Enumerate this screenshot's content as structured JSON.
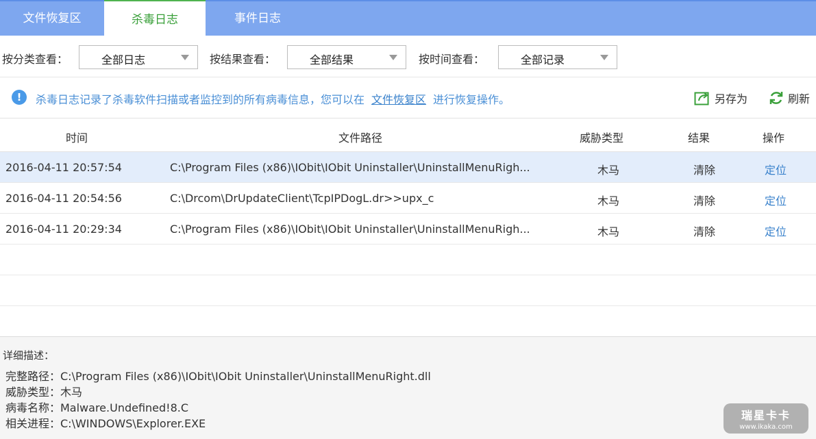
{
  "tabs": [
    {
      "label": "文件恢复区",
      "active": false
    },
    {
      "label": "杀毒日志",
      "active": true
    },
    {
      "label": "事件日志",
      "active": false
    }
  ],
  "filters": {
    "category_label": "按分类查看：",
    "category_value": "全部日志",
    "result_label": "按结果查看：",
    "result_value": "全部结果",
    "time_label": "按时间查看：",
    "time_value": "全部记录"
  },
  "info": {
    "text_before": "杀毒日志记录了杀毒软件扫描或者监控到的所有病毒信息，您可以在",
    "link": "文件恢复区",
    "text_after": "进行恢复操作。",
    "save_as": "另存为",
    "refresh": "刷新"
  },
  "table": {
    "headers": {
      "time": "时间",
      "path": "文件路径",
      "type": "威胁类型",
      "result": "结果",
      "op": "操作"
    },
    "rows": [
      {
        "time": "2016-04-11 20:57:54",
        "path": "C:\\Program Files (x86)\\IObit\\IObit Uninstaller\\UninstallMenuRigh...",
        "type": "木马",
        "result": "清除",
        "op": "定位",
        "selected": true
      },
      {
        "time": "2016-04-11 20:54:56",
        "path": "C:\\Drcom\\DrUpdateClient\\TcpIPDogL.dr>>upx_c",
        "type": "木马",
        "result": "清除",
        "op": "定位",
        "selected": false
      },
      {
        "time": "2016-04-11 20:29:34",
        "path": "C:\\Program Files (x86)\\IObit\\IObit Uninstaller\\UninstallMenuRigh...",
        "type": "木马",
        "result": "清除",
        "op": "定位",
        "selected": false
      }
    ]
  },
  "detail": {
    "title": "详细描述：",
    "full_path": "完整路径：C:\\Program Files (x86)\\IObit\\IObit Uninstaller\\UninstallMenuRight.dll",
    "threat_type": "威胁类型：木马",
    "virus_name": "病毒名称：Malware.Undefined!8.C",
    "process": "相关进程：C:\\WINDOWS\\Explorer.EXE"
  },
  "watermark": {
    "brand": "瑞星卡卡",
    "url": "www.ikaka.com"
  },
  "colors": {
    "tabbar": "#7ea7ef",
    "active_tab_text": "#3aa03a",
    "link": "#3a82cc",
    "selected_row": "#e3edfb"
  }
}
